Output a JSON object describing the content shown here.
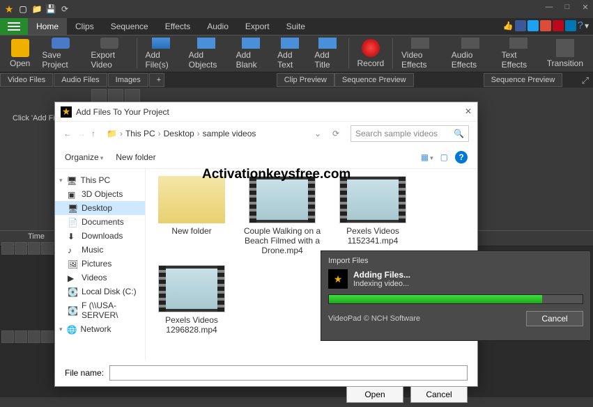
{
  "menu": {
    "items": [
      "Home",
      "Clips",
      "Sequence",
      "Effects",
      "Audio",
      "Export",
      "Suite"
    ],
    "active": "Home"
  },
  "toolbar": {
    "open": "Open",
    "save": "Save Project",
    "export": "Export Video",
    "addfiles": "Add File(s)",
    "addobj": "Add Objects",
    "addblank": "Add Blank",
    "addtext": "Add Text",
    "addtitle": "Add Title",
    "record": "Record",
    "vfx": "Video Effects",
    "afx": "Audio Effects",
    "tfx": "Text Effects",
    "trans": "Transition"
  },
  "panelTabs": {
    "video": "Video Files",
    "audio": "Audio Files",
    "images": "Images",
    "plus": "+"
  },
  "previewTabs": {
    "clip": "Clip Preview",
    "seq1": "Sequence Preview",
    "seq2": "Sequence Preview"
  },
  "hint": "Click 'Add Fil",
  "timeline": {
    "header": "Time"
  },
  "dialog": {
    "title": "Add Files To Your Project",
    "breadcrumb": [
      "This PC",
      "Desktop",
      "sample videos"
    ],
    "search_placeholder": "Search sample videos",
    "organize": "Organize",
    "newfolder": "New folder",
    "side": [
      {
        "label": "This PC",
        "icon": "pc"
      },
      {
        "label": "3D Objects",
        "icon": "3d"
      },
      {
        "label": "Desktop",
        "icon": "desktop",
        "selected": true
      },
      {
        "label": "Documents",
        "icon": "doc"
      },
      {
        "label": "Downloads",
        "icon": "dl"
      },
      {
        "label": "Music",
        "icon": "music"
      },
      {
        "label": "Pictures",
        "icon": "pic"
      },
      {
        "label": "Videos",
        "icon": "vid"
      },
      {
        "label": "Local Disk (C:)",
        "icon": "disk"
      },
      {
        "label": "F (\\\\USA-SERVER\\",
        "icon": "disk"
      },
      {
        "label": "Network",
        "icon": "net"
      }
    ],
    "files": [
      {
        "name": "New folder",
        "type": "folder"
      },
      {
        "name": "Couple Walking on a Beach Filmed with a Drone.mp4",
        "type": "video"
      },
      {
        "name": "Pexels Videos 1152341.mp4",
        "type": "video"
      },
      {
        "name": "Pexels Videos 1296828.mp4",
        "type": "video"
      }
    ],
    "filename_label": "File name:",
    "open_btn": "Open",
    "cancel_btn": "Cancel"
  },
  "progress": {
    "header": "Import Files",
    "title": "Adding Files...",
    "status": "Indexing video...",
    "percent": 84,
    "footer": "VideoPad © NCH Software",
    "cancel": "Cancel"
  },
  "watermark": "Activationkeysfree.com"
}
